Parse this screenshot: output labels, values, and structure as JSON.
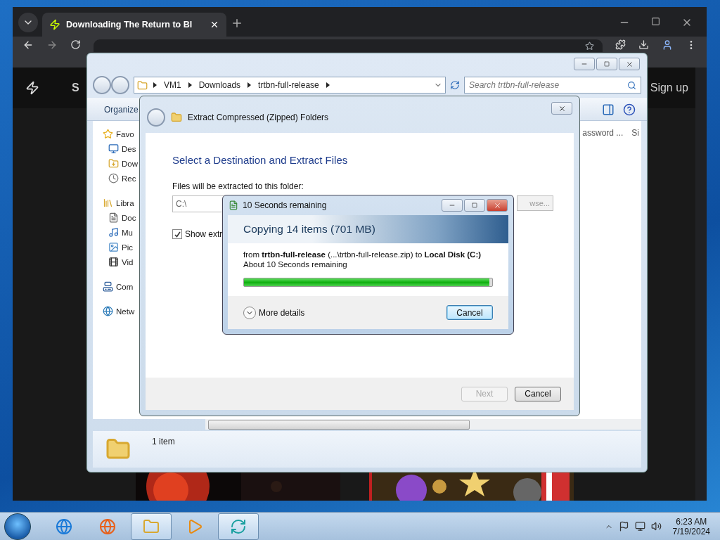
{
  "browser": {
    "tab": {
      "title": "Downloading The Return to Bl"
    },
    "site": {
      "logo_text": "S",
      "sign_up": "Sign up"
    }
  },
  "explorer": {
    "breadcrumbs": [
      "VM1",
      "Downloads",
      "trtbn-full-release"
    ],
    "search": {
      "placeholder": "Search trtbn-full-release"
    },
    "toolbar": [
      "Organize"
    ],
    "nav": [
      {
        "label": "Favo",
        "children": [
          {
            "label": "Des"
          },
          {
            "label": "Dow"
          },
          {
            "label": "Rec"
          }
        ]
      },
      {
        "label": "Libra",
        "children": [
          {
            "label": "Doc"
          },
          {
            "label": "Mu"
          },
          {
            "label": "Pic"
          },
          {
            "label": "Vid"
          }
        ]
      },
      {
        "label": "Com"
      },
      {
        "label": "Netw"
      }
    ],
    "columns": [
      "assword ...",
      "Si"
    ],
    "status": "1 item"
  },
  "extract_dialog": {
    "title": "Extract Compressed (Zipped) Folders",
    "heading": "Select a Destination and Extract Files",
    "folder_label": "Files will be extracted to this folder:",
    "folder_value": "C:\\",
    "browse": "wse...",
    "show_files": {
      "label": "Show extr",
      "checked": true
    },
    "buttons": [
      {
        "label": "Next",
        "disabled": true
      },
      {
        "label": "Cancel",
        "disabled": false
      }
    ]
  },
  "copy_dialog": {
    "title": "10 Seconds remaining",
    "heading": "Copying 14 items (701 MB)",
    "from": "from **trtbn-full-release** (...\\trtbn-full-release.zip) to **Local Disk (C:)**",
    "remaining": "About 10 Seconds remaining",
    "level": 0.99,
    "details": "More details",
    "cancel": "Cancel"
  },
  "taskbar": {
    "apps": [
      {
        "selected": false
      },
      {
        "selected": false
      },
      {
        "selected": true
      },
      {
        "selected": false
      },
      {
        "selected": true
      }
    ],
    "time": "6:23 AM",
    "date": "7/19/2024"
  }
}
